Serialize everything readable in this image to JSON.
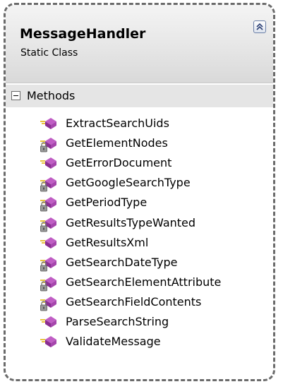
{
  "class": {
    "name": "MessageHandler",
    "kind": "Static Class",
    "collapse_icon": "double-chevron-up-icon"
  },
  "compartment": {
    "label": "Methods",
    "expander_icon": "minus-box-icon"
  },
  "methods": [
    {
      "name": "ExtractSearchUids",
      "access": "public"
    },
    {
      "name": "GetElementNodes",
      "access": "private"
    },
    {
      "name": "GetErrorDocument",
      "access": "public"
    },
    {
      "name": "GetGoogleSearchType",
      "access": "private"
    },
    {
      "name": "GetPeriodType",
      "access": "private"
    },
    {
      "name": "GetResultsTypeWanted",
      "access": "private"
    },
    {
      "name": "GetResultsXml",
      "access": "public"
    },
    {
      "name": "GetSearchDateType",
      "access": "private"
    },
    {
      "name": "GetSearchElementAttribute",
      "access": "private"
    },
    {
      "name": "GetSearchFieldContents",
      "access": "private"
    },
    {
      "name": "ParseSearchString",
      "access": "public"
    },
    {
      "name": "ValidateMessage",
      "access": "public"
    }
  ],
  "colors": {
    "border": "#6b6b6b",
    "method_icon": "#c05ec5",
    "lock_icon": "#7a7a7a"
  }
}
